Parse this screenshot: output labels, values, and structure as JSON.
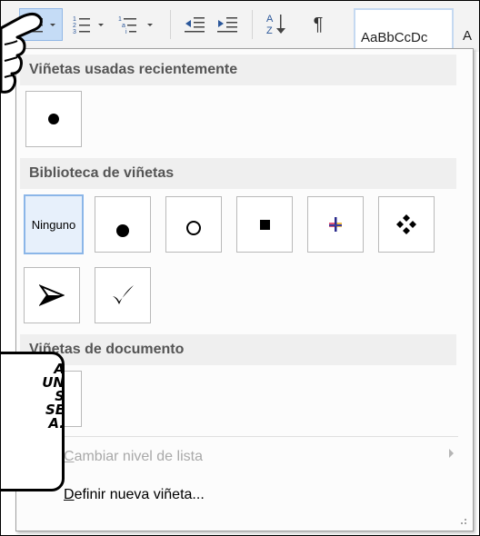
{
  "ribbon": {
    "styles_sample": "AaBbCcDc",
    "styles_next": "A",
    "sort_icon_text": "A\nZ",
    "pilcrow": "¶"
  },
  "dropdown": {
    "recent": {
      "heading": "Viñetas usadas recientemente",
      "items": [
        {
          "type": "dot"
        }
      ]
    },
    "library": {
      "heading": "Biblioteca de viñetas",
      "items": [
        {
          "type": "none",
          "label": "Ninguno",
          "selected": true
        },
        {
          "type": "dot"
        },
        {
          "type": "ring"
        },
        {
          "type": "square"
        },
        {
          "type": "colored-cross"
        },
        {
          "type": "diamond-cluster"
        },
        {
          "type": "arrowhead"
        },
        {
          "type": "checkmark"
        }
      ]
    },
    "document": {
      "heading": "Viñetas de documento",
      "items": [
        {
          "type": "empty"
        }
      ]
    },
    "menu": {
      "change_level": {
        "first": "C",
        "rest": "ambiar nivel de lista",
        "disabled": true
      },
      "define_new": {
        "first": "D",
        "rest": "efinir nueva viñeta..."
      }
    }
  },
  "comic": {
    "bubble_text": "A\n UN\nS\nSE\nA."
  }
}
